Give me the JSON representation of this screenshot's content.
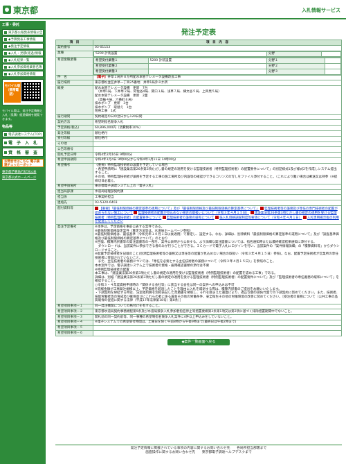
{
  "header": {
    "logo_text": "東京都",
    "system_title": "入札情報サービス"
  },
  "sidebar": {
    "section1": "工事・委託",
    "items": [
      "東京都公報発表情報公告",
      "◆予算発表工事情報",
      "◆発注予定情報",
      "◆入札・見積(経過)情報",
      "◆入札結果一覧",
      "◆入札参加資格業者名簿",
      "◆入札参加資格情報"
    ],
    "mobile_label": "モバイル版（携帯電話）",
    "mobile_note": "モバイル版は、発注予定情報と入札（見積）経過情報を閲覧できます。",
    "section2": "物品等",
    "items2": [
      "電子調達システム(TOP)",
      "電　子　入　札",
      "資　格　審　査"
    ],
    "checker": "お問合せはこちら 電子調達チェッカーボット",
    "links": [
      "東京都予算執行状況公表",
      "東京都公式ホームページ"
    ]
  },
  "page_title": "発注予定表",
  "table": {
    "col_item": "項　目",
    "col_content": "項　目　内　容",
    "rows": {
      "contract_no": {
        "label": "契約番号",
        "value": "03-01153"
      },
      "industry": {
        "label": "業種",
        "value": "5200 計装設置",
        "bunya_label": "分野"
      },
      "hope": {
        "label": "希望業種業種",
        "r1_label": "希望受付業種１",
        "r1_value": "5200 計装設置",
        "r1_bunya": "分野１",
        "r2_label": "希望受付業種２",
        "r2_bunya": "分野２",
        "r3_label": "希望受付業種３",
        "r3_bunya": "分野３"
      },
      "name": {
        "label": "件　名",
        "tag": "【電子】",
        "value": "井草１局外８か所配水本管テレメータ設備改良工事"
      },
      "location": {
        "label": "履行場所",
        "value": "東京都杉並区井草一丁目25番地　井草1局外８か所"
      },
      "summary": {
        "label": "概要",
        "value": "配水本管テレメータ設備　更新　7台\n　（井草1局、下井草２局、阿佐谷4局、関口１局、浅草７局、練文谷５局、上目黒５局）\n配水本管テレメータ設備　更新　2面\n　（高輪４局、六番町８局）\n排水ポンプ　更新　3台\n排水ポンプ　取替え　1台\n附帯工事　1式"
      },
      "period": {
        "label": "履行期間",
        "value": "契約確定の日の翌日から120日間"
      },
      "method": {
        "label": "契約方法",
        "value": "希望制指名競争入札"
      },
      "price": {
        "label": "予定価格(税込)",
        "value": "60,896,000円（消費税率10%）"
      },
      "place": {
        "label": "発注等級",
        "value": "順位格付"
      },
      "type": {
        "label": "受付等級",
        "value": "順位格付"
      },
      "other": {
        "label": "その他",
        "value": ""
      },
      "announce": {
        "label": "公告等番号",
        "value": ""
      },
      "open_date": {
        "label": "開札予定日時",
        "value": "令和4年2月16日 9時00分"
      },
      "hope_period": {
        "label": "希望申請期間",
        "value": "令和4年1月4日 9時00分から令和4年1月11日 14時00分"
      },
      "hope_note": {
        "label": "希望備考",
        "value": "《重要》特例監理技術者の設置を予定している場合\n・希望申請時に「建設業法第26条第3項ただし書の規定の適用を受ける監理技術者（特例監理技術者）の配置要件について」の別記様式1及び様式2を作成しシステム提出すること。\nその他、特例監理技術者が兼務を予定する工事の施工場所及び内容等の確認ができるコリンズの写しをファイル添付すること。（これにより難い場合は郵送又は持参（※提締切日必着)）。"
      },
      "contact_dept": {
        "label": "希望申請場所",
        "value": "東京都電子調達システム上の「電子入札」"
      },
      "dept": {
        "label": "担当局部課",
        "value": "水道局経理部契約課"
      },
      "section": {
        "label": "担当係",
        "value": "工事契約担当"
      },
      "phone": {
        "label": "連絡先",
        "value": "03-5320-6403"
      },
      "files": {
        "label": "配付資料等",
        "links": [
          "【重要】「最低制限価格の算定基準の適用について」及び「最低制限価格及び最低制限価格の算定基準について」",
          "監理技術者等の兼務及び専任の専門技術者の配置が認められない施工について",
          "監理技術者の配置が見込めない場合の取扱いについて（令和３年４月１５日）",
          "建設業法第26条第3項ただし書の規定の適用を受ける監理技術者（特例監理技術者）の配置要件について",
          "監理技術者の兼務の緩和について",
          "低入札価格調査制度等要領について（令和４年４月１日）",
          "入札専用掲示板の利用を促進してください"
        ]
      },
      "issue_note": {
        "label": "発注予定備考",
        "value": "※本件は、予定価格を事前公表する案件である。\n※最低制限価格設定案件（算定方法等は、水道局ホームページ参照）\n※最低制限価格は、最低基準（令和元年１０月１日以後適用）で算定し、設定する。なお、詳細は、別添資料「最低制限価格の算定基準の運用について」及び「調査基準価格及び最低制限価格の算定基準について」のとおり\n※回復、積算内訳書等の発注図書等の一部を、案件公表時から公表する。より詳細な発注図書については、指名通知時または最終確認結果通知に添付する。\n　ダウンロードは、当該案件に参加できる者のみが行うことができる。ＩＣカードで電子入札にログインを行い、当該案件の「案件情報詳細」の「積算資料等」からダウンロードすること。\n※配置予定技術者を記載のこと(別添監理技術者等の兼務又は専任等の配置が見込めない場合の取扱い（令和３年４月１５日）参照)。なお、配置予定技術者が営業所の専任技術者に登録されていないこと。\n　また、主任技術者の兼務については、「専任を必要とする主任技術者の兼務について（令和３年４月１５日）」を参照のこと。\n本本案件では、電子調達システム上で技術者の資格・雇用確認書類の添付は不要\n※特例監理技術者の配置\n本工事は、「建設業法第26条第3項ただし書の規定の適用を受ける監理技術者（特例監理技術者）の配置を認める工事」である。\n詳細は、別紙「建設業法第26条第3項ただし書の規定の適用を受ける監理技術者（特例監理技術者）の配置要件について」及び「監理技術者の専任義務の緩和について」を確認すること。\n○令和３・４年度資格申請時の「関係する会社等」に該当する会社は同一の案件への申込みは不可\n※同様金額が工事発注規模以上、予定価格を超過したことを理由に入札を辞退する際は、積算内訳書のご提出をお願いいたします。\n・下請契約を締結する時は、法定福利費を別枠表記した見積書を徴取し、それを踏まえた書面により、適正な額の請負代金での下請契約に努めてください。また、技術者、技能労働者等の育成及び確保並びにこれらの者に係る賃金その他の労働条件、安全衛生その他の労働環境の改善に努めてください。［受注者の責務について（公共工事の品質確保の促進に関する法律（平成17年法律第18号）第8条）］"
      },
      "hope_items": [
        {
          "label": "希望項目事項－１",
          "value": "同一発注機関についての格付けを有すること。"
        },
        {
          "label": "希望項目事項－２",
          "value": "東京都水道局契約事務規程第9条及び水道局競争入札参加者指名停止等措置要綱第3条第1項又は第2項に基づく排除措置期間中でないこと。"
        },
        {
          "label": "希望項目事項－３",
          "value": "開札前の同一契約前等、同一事種の希望制指名競争入札案件に4件以上申込みをしていないこと。"
        },
        {
          "label": "希望項目事項－４",
          "value": "※電子システムでの希望受付時間は、土曜日を除く午前8時から午後9時まで(最終日は午後2時まで)"
        },
        {
          "label": "希望項目事項－５",
          "value": ""
        },
        {
          "label": "希望項目事項－６",
          "value": ""
        }
      ]
    }
  },
  "back_button": "◆案件一覧画面へ戻る",
  "footer": {
    "line1": "発注予定情報に掲載されている事項の内容に関するお問い合わせ先　　各局所担当部署まで",
    "line2": "画面操作に関するお問い合わせ先　　東京都電子調達ヘルプデスクまで"
  },
  "colors": {
    "brand_green": "#2e8b3a",
    "header_cell": "#cfe6d2",
    "label_cell": "#e6f2e8",
    "accent_orange": "#f08000"
  }
}
